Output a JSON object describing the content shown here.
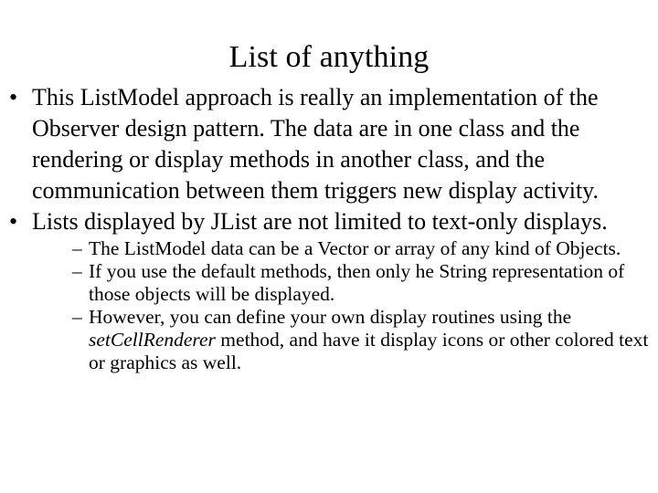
{
  "slide": {
    "title": "List of anything",
    "bullet_marker": "•",
    "sub_bullet_marker": "–",
    "text_color": "#000000",
    "background_color": "#ffffff",
    "bullets": [
      {
        "level": 1,
        "text": "This ListModel approach is really an implementation of the Observer design pattern. The data are in one class and the rendering or display methods in another class, and the communication between them triggers new display activity."
      },
      {
        "level": 1,
        "text": "Lists displayed by JList are not limited to text-only displays."
      }
    ],
    "sub_bullets": [
      {
        "level": 2,
        "text": "The ListModel data can be a Vector or array of any kind of Objects."
      },
      {
        "level": 2,
        "text": "If you use the default methods, then only he String representation of those objects will be displayed."
      },
      {
        "level": 2,
        "text_before_italic": "However, you can define your own display routines using the ",
        "italic_text": "setCellRenderer",
        "text_after_italic": " method, and have it display icons or other colored text or graphics as well."
      }
    ]
  }
}
